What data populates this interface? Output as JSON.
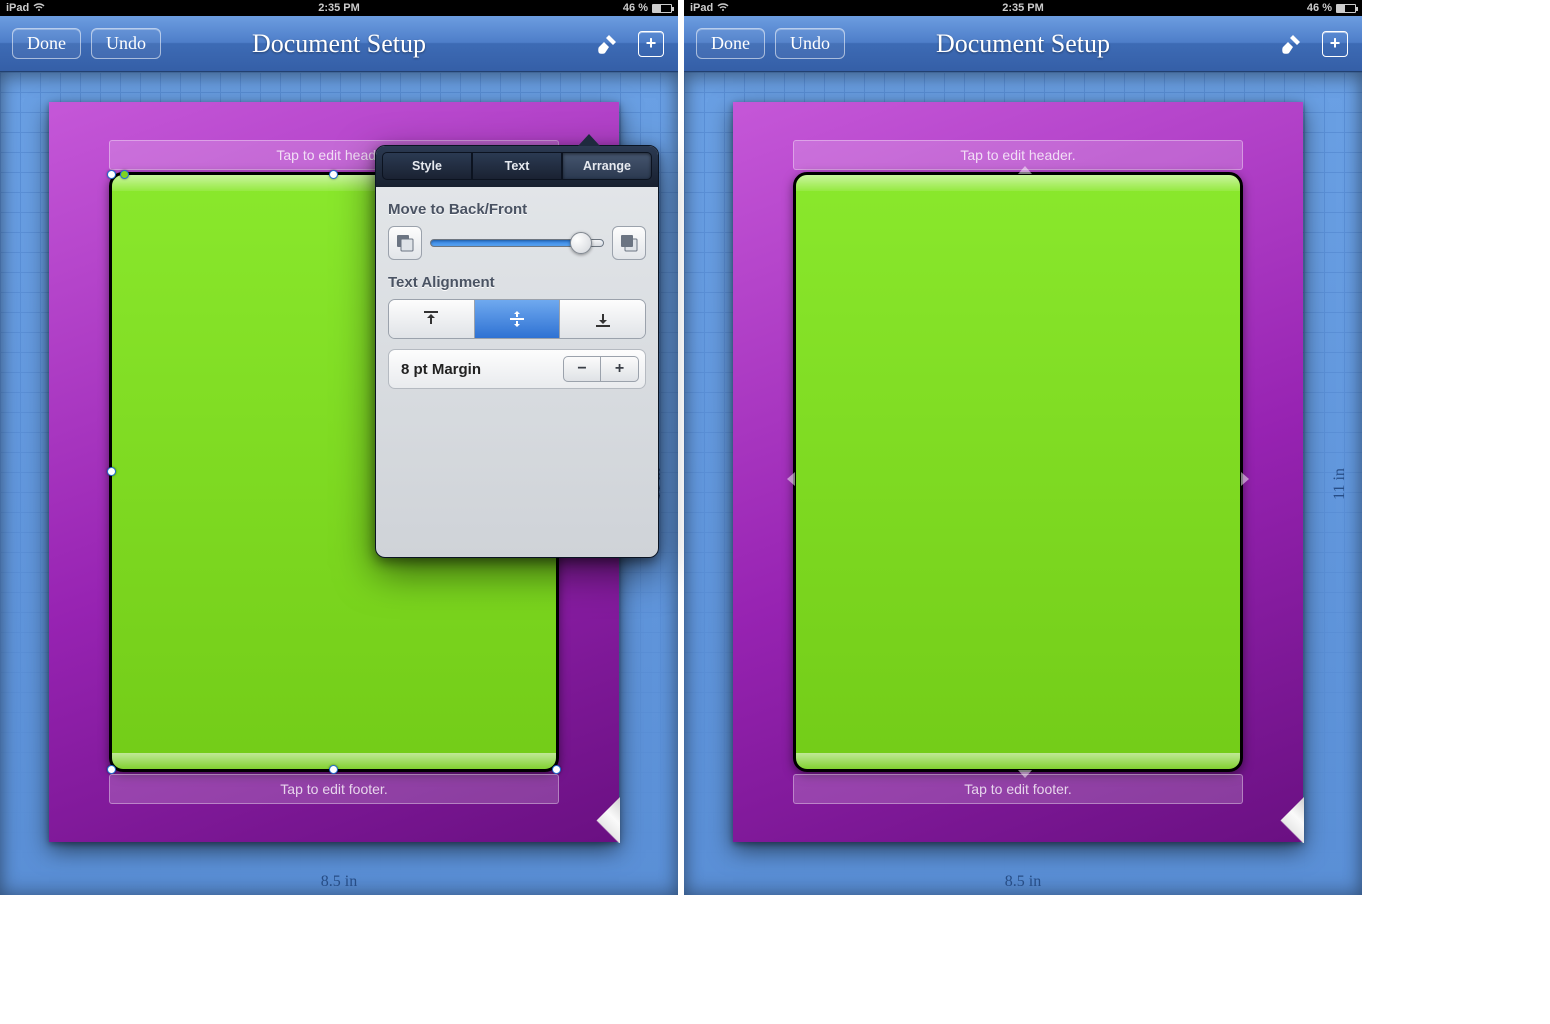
{
  "statusbar": {
    "device": "iPad",
    "time": "2:35 PM",
    "battery_pct": "46 %",
    "battery_fill": 46
  },
  "toolbar": {
    "done": "Done",
    "undo": "Undo",
    "title": "Document Setup"
  },
  "page": {
    "header_placeholder": "Tap to edit header.",
    "footer_placeholder": "Tap to edit footer.",
    "width_label": "8.5 in",
    "height_label": "11 in"
  },
  "popover": {
    "tabs": {
      "style": "Style",
      "text": "Text",
      "arrange": "Arrange"
    },
    "active_tab": "arrange",
    "move_label": "Move to Back/Front",
    "align_label": "Text Alignment",
    "margin_label": "8 pt Margin",
    "stepper": {
      "minus": "−",
      "plus": "+"
    }
  }
}
